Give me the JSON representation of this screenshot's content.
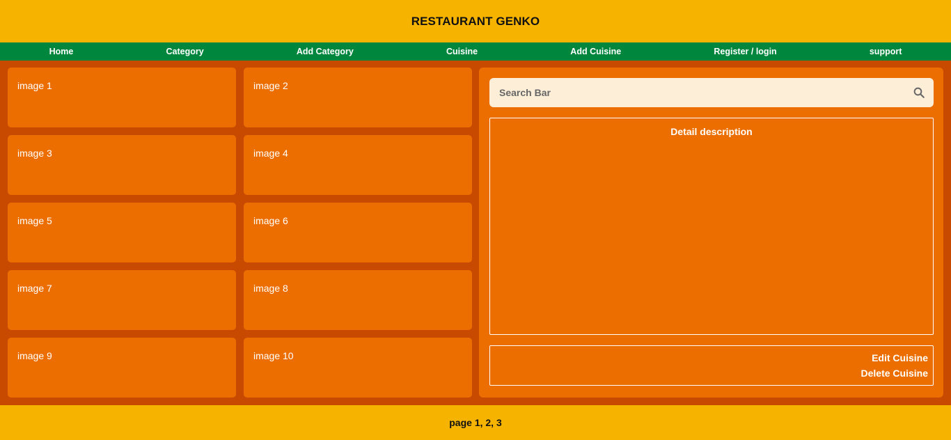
{
  "header": {
    "title": "RESTAURANT GENKO"
  },
  "nav": {
    "items": [
      {
        "label": "Home"
      },
      {
        "label": "Category"
      },
      {
        "label": "Add Category"
      },
      {
        "label": "Cuisine"
      },
      {
        "label": "Add Cuisine"
      },
      {
        "label": "Register / login"
      },
      {
        "label": "support"
      }
    ]
  },
  "cards": [
    {
      "label": "image 1"
    },
    {
      "label": "image 2"
    },
    {
      "label": "image 3"
    },
    {
      "label": "image 4"
    },
    {
      "label": "image 5"
    },
    {
      "label": "image 6"
    },
    {
      "label": "image 7"
    },
    {
      "label": "image 8"
    },
    {
      "label": "image 9"
    },
    {
      "label": "image 10"
    }
  ],
  "search": {
    "placeholder": "Search Bar",
    "icon": "search-icon"
  },
  "detail": {
    "title": "Detail description"
  },
  "actions": {
    "edit_label": "Edit Cuisine",
    "delete_label": "Delete Cuisine"
  },
  "footer": {
    "pagination": "page 1, 2, 3"
  },
  "colors": {
    "header": "#f6b300",
    "nav": "#00873d",
    "main": "#c84a00",
    "card": "#ec6e00",
    "search": "#fdeed8"
  }
}
